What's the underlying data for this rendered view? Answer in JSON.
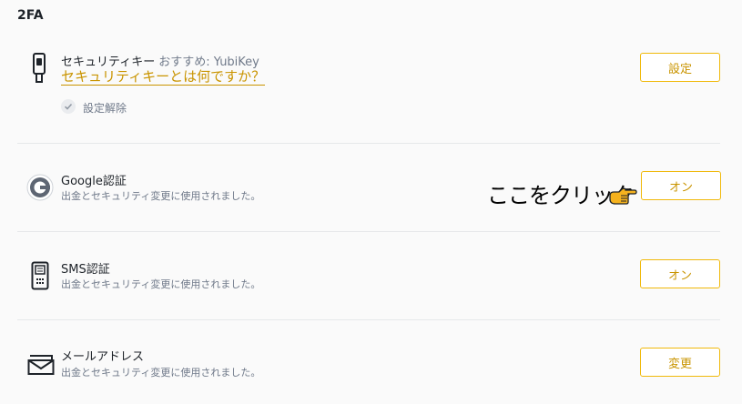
{
  "section": {
    "title": "2FA"
  },
  "security_key": {
    "icon": "usb-key-icon",
    "title": "セキュリティキー",
    "recommend": "おすすめ: YubiKey",
    "link": "セキュリティキーとは何ですか？",
    "status_icon": "check-circle-icon",
    "status": "設定解除",
    "button": "設定"
  },
  "google_auth": {
    "icon": "google-authenticator-icon",
    "title": "Google認証",
    "desc": "出金とセキュリティ変更に使用されました。",
    "button": "オン"
  },
  "sms_auth": {
    "icon": "phone-sms-icon",
    "title": "SMS認証",
    "desc": "出金とセキュリティ変更に使用されました。",
    "button": "オン"
  },
  "email": {
    "icon": "envelope-icon",
    "title": "メールアドレス",
    "desc": "出金とセキュリティ変更に使用されました。",
    "button": "変更"
  },
  "annotation": {
    "text": "ここをクリック",
    "icon": "pointing-hand-icon"
  },
  "colors": {
    "accent": "#f0b90b",
    "accent_text": "#c99400",
    "text": "#1e2329",
    "muted": "#707a8a",
    "divider": "#e6e8ea"
  }
}
